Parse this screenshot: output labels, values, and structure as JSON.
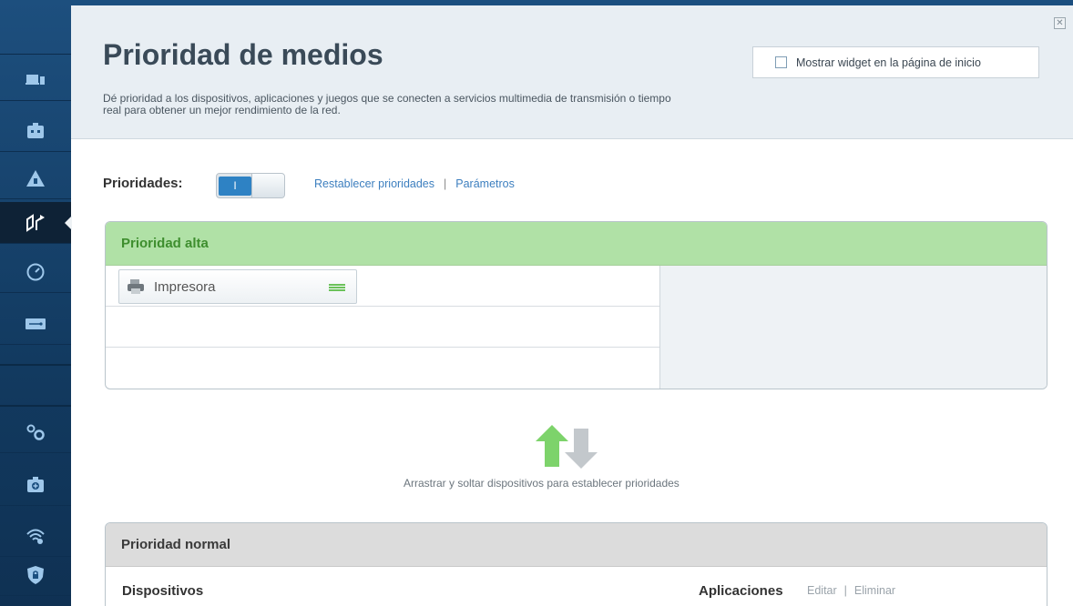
{
  "header": {
    "title": "Prioridad de medios",
    "description": "Dé prioridad a los dispositivos, aplicaciones y juegos que se conecten a servicios multimedia de transmisión o tiempo real para obtener un mejor rendimiento de la red.",
    "widget_checkbox_label": "Mostrar widget en la página de inicio",
    "close_glyph": "✕"
  },
  "sidebar": {
    "items": [
      {
        "icon": "devices-icon"
      },
      {
        "icon": "parental-controls-icon"
      },
      {
        "icon": "guest-access-icon"
      },
      {
        "icon": "media-prioritization-icon",
        "active": true
      },
      {
        "icon": "speed-test-icon"
      },
      {
        "icon": "external-storage-icon"
      },
      {
        "icon": "connectivity-icon"
      },
      {
        "icon": "troubleshooting-icon"
      },
      {
        "icon": "wireless-icon"
      },
      {
        "icon": "security-icon"
      }
    ]
  },
  "priorities": {
    "label": "Prioridades:",
    "toggle_on_text": "I",
    "reset_link": "Restablecer prioridades",
    "separator": "|",
    "settings_link": "Parámetros"
  },
  "high_priority": {
    "title": "Prioridad alta",
    "devices": [
      {
        "name": "Impresora",
        "icon": "printer-icon"
      }
    ]
  },
  "drag_hint": "Arrastrar y soltar dispositivos para establecer prioridades",
  "normal_priority": {
    "title": "Prioridad normal",
    "devices_header": "Dispositivos",
    "apps_header": "Aplicaciones",
    "edit_link": "Editar",
    "separator": "|",
    "delete_link": "Eliminar"
  },
  "colors": {
    "sidebar": "#123a60",
    "header_bg": "#e8eef3",
    "high_priority_bg": "#b0e1a6",
    "high_priority_text": "#3e8e2e",
    "normal_priority_bg": "#dcdcdc",
    "link": "#3d7fbf",
    "toggle_on": "#2e82c4"
  }
}
